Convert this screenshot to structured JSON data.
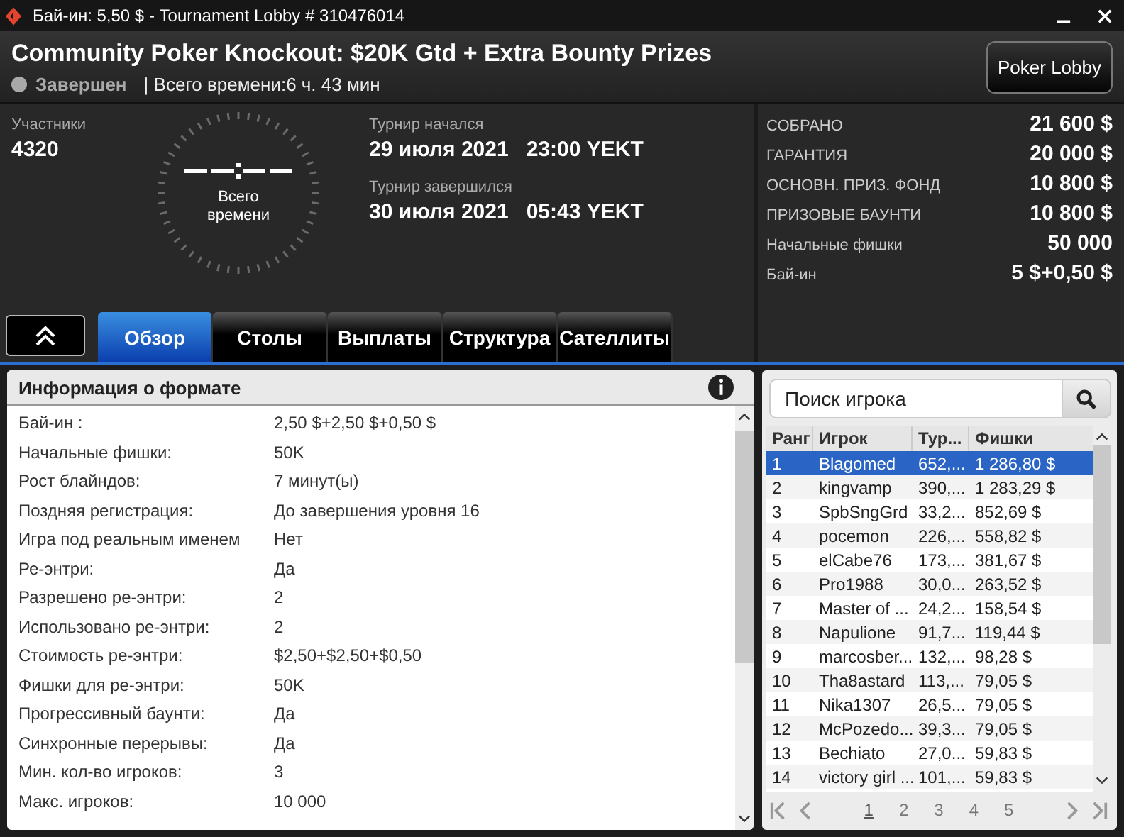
{
  "window": {
    "title": "Бай-ин: 5,50 $ - Tournament Lobby # 310476014"
  },
  "header": {
    "title": "Community Poker Knockout: $20K Gtd + Extra Bounty Prizes",
    "status": "Завершен",
    "status_active": false,
    "total_time": "| Всего времени:6 ч. 43 мин",
    "lobby_button": "Poker Lobby"
  },
  "participants": {
    "label": "Участники",
    "value": "4320"
  },
  "timer": {
    "caption": "Всего времени"
  },
  "dates": [
    {
      "label": "Турнир начался",
      "value": "29 июля 2021   23:00 YEKT"
    },
    {
      "label": "Турнир завершился",
      "value": "30 июля 2021   05:43 YEKT"
    }
  ],
  "prizes": [
    {
      "label": "СОБРАНО",
      "value": "21 600 $"
    },
    {
      "label": "ГАРАНТИЯ",
      "value": "20 000 $"
    },
    {
      "label": "ОСНОВН. ПРИЗ. ФОНД",
      "value": "10 800 $"
    },
    {
      "label": "ПРИЗОВЫЕ БАУНТИ",
      "value": "10 800 $"
    },
    {
      "label": "Начальные фишки",
      "value": "50 000"
    },
    {
      "label": "Бай-ин",
      "value": "5 $+0,50 $"
    }
  ],
  "tabs": [
    {
      "label": "Обзор",
      "selected": true
    },
    {
      "label": "Столы",
      "selected": false
    },
    {
      "label": "Выплаты",
      "selected": false
    },
    {
      "label": "Структура",
      "selected": false
    },
    {
      "label": "Сателлиты",
      "selected": false
    }
  ],
  "format": {
    "title": "Информация о формате",
    "rows": [
      {
        "label": "Бай-ин :",
        "value": "2,50 $+2,50 $+0,50 $"
      },
      {
        "label": "Начальные фишки:",
        "value": "50K"
      },
      {
        "label": "Рост блайндов:",
        "value": "7 минут(ы)"
      },
      {
        "label": "Поздняя регистрация:",
        "value": "До завершения уровня 16"
      },
      {
        "label": "Игра под реальным именем",
        "value": "Нет"
      },
      {
        "label": "Ре-энтри:",
        "value": "Да"
      },
      {
        "label": "Разрешено ре-энтри:",
        "value": "2"
      },
      {
        "label": "Использовано ре-энтри:",
        "value": "2"
      },
      {
        "label": "Стоимость ре-энтри:",
        "value": "$2,50+$2,50+$0,50"
      },
      {
        "label": "Фишки для ре-энтри:",
        "value": "50K"
      },
      {
        "label": "Прогрессивный баунти:",
        "value": "Да"
      },
      {
        "label": "Синхронные перерывы:",
        "value": "Да"
      },
      {
        "label": "Мин. кол-во игроков:",
        "value": "3"
      },
      {
        "label": "Макс. игроков:",
        "value": "10 000"
      }
    ]
  },
  "players": {
    "search": {
      "placeholder": "Поиск игрока"
    },
    "columns": [
      "Ранг",
      "Игрок",
      "Тур...",
      "Фишки"
    ],
    "rows": [
      {
        "rank": "1",
        "player": "Blagomed",
        "column_3": "652,...",
        "chips": "1 286,80 $",
        "selected": true
      },
      {
        "rank": "2",
        "player": "kingvamp",
        "column_3": "390,...",
        "chips": "1 283,29 $",
        "selected": false
      },
      {
        "rank": "3",
        "player": "SpbSngGrd",
        "column_3": "33,2...",
        "chips": "852,69 $",
        "selected": false
      },
      {
        "rank": "4",
        "player": "pocemon",
        "column_3": "226,...",
        "chips": "558,82 $",
        "selected": false
      },
      {
        "rank": "5",
        "player": "elCabe76",
        "column_3": "173,...",
        "chips": "381,67 $",
        "selected": false
      },
      {
        "rank": "6",
        "player": "Pro1988",
        "column_3": "30,0...",
        "chips": "263,52 $",
        "selected": false
      },
      {
        "rank": "7",
        "player": "Master of ...",
        "column_3": "24,2...",
        "chips": "158,54 $",
        "selected": false
      },
      {
        "rank": "8",
        "player": "Napulione",
        "column_3": "91,7...",
        "chips": "119,44 $",
        "selected": false
      },
      {
        "rank": "9",
        "player": "marcosber...",
        "column_3": "132,...",
        "chips": "98,28 $",
        "selected": false
      },
      {
        "rank": "10",
        "player": "Tha8astard",
        "column_3": "113,...",
        "chips": "79,05 $",
        "selected": false
      },
      {
        "rank": "11",
        "player": "Nika1307",
        "column_3": "26,5...",
        "chips": "79,05 $",
        "selected": false
      },
      {
        "rank": "12",
        "player": "McPozedo...",
        "column_3": "39,3...",
        "chips": "79,05 $",
        "selected": false
      },
      {
        "rank": "13",
        "player": "Bechiato",
        "column_3": "27,0...",
        "chips": "59,83 $",
        "selected": false
      },
      {
        "rank": "14",
        "player": "victory girl ...",
        "column_3": "101,...",
        "chips": "59,83 $",
        "selected": false
      }
    ],
    "pages": [
      {
        "label": "1",
        "selected": true
      },
      {
        "label": "2",
        "selected": false
      },
      {
        "label": "3",
        "selected": false
      },
      {
        "label": "4",
        "selected": false
      },
      {
        "label": "5",
        "selected": false
      }
    ]
  }
}
